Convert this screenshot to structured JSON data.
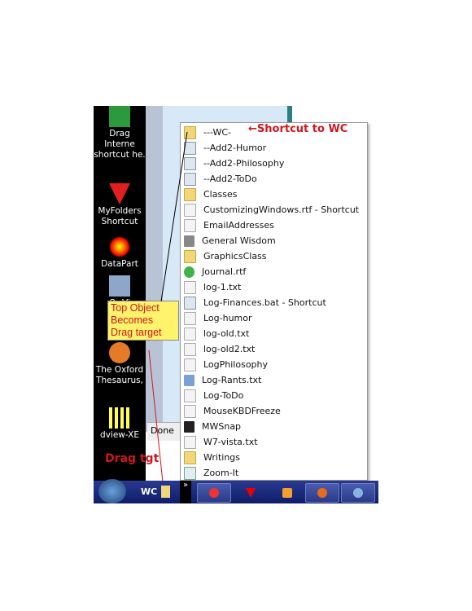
{
  "desktop": {
    "icons": [
      {
        "label": "Drag Interne shortcut he.",
        "icon": "green-arrow-shortcut-icon"
      },
      {
        "label": "MyFolders Shortcut",
        "icon": "red-triangles-icon"
      },
      {
        "label": "DataPart",
        "icon": "starburst-icon"
      },
      {
        "label": "Or Vi",
        "icon": "virtualbox-cube-icon"
      },
      {
        "label": "The Oxford Thesaurus,",
        "icon": "oxford-thesaurus-icon"
      },
      {
        "label": "dview-XE",
        "icon": "dview-icon"
      }
    ]
  },
  "window": {
    "done_label": "Done"
  },
  "jump_menu": {
    "items": [
      {
        "label": "---WC-",
        "icon": "folder"
      },
      {
        "label": "--Add2-Humor",
        "icon": "gear"
      },
      {
        "label": "--Add2-Philosophy",
        "icon": "gear"
      },
      {
        "label": "--Add2-ToDo",
        "icon": "gear"
      },
      {
        "label": "Classes",
        "icon": "folder"
      },
      {
        "label": "CustomizingWindows.rtf - Shortcut",
        "icon": "doc"
      },
      {
        "label": "EmailAddresses",
        "icon": "doc"
      },
      {
        "label": "General Wisdom",
        "icon": "print"
      },
      {
        "label": "GraphicsClass",
        "icon": "folder"
      },
      {
        "label": "Journal.rtf",
        "icon": "play"
      },
      {
        "label": "log-1.txt",
        "icon": "doc"
      },
      {
        "label": "Log-Finances.bat - Shortcut",
        "icon": "gear"
      },
      {
        "label": "Log-humor",
        "icon": "doc"
      },
      {
        "label": "log-old.txt",
        "icon": "doc"
      },
      {
        "label": "log-old2.txt",
        "icon": "doc"
      },
      {
        "label": "LogPhilosophy",
        "icon": "doc"
      },
      {
        "label": "Log-Rants.txt",
        "icon": "people"
      },
      {
        "label": "Log-ToDo",
        "icon": "doc"
      },
      {
        "label": "MouseKBDFreeze",
        "icon": "doc"
      },
      {
        "label": "MWSnap",
        "icon": "cam"
      },
      {
        "label": "W7-vista.txt",
        "icon": "doc"
      },
      {
        "label": "Writings",
        "icon": "folder"
      },
      {
        "label": "Zoom-It",
        "icon": "zoom"
      }
    ]
  },
  "annotations": {
    "shortcut_note": "←Shortcut to WC",
    "callout": [
      "Top Object",
      "Becomes",
      "Drag target"
    ],
    "drag_tgt": "Drag tgt",
    "color": "#d0161c"
  },
  "taskbar": {
    "toolbar_label": "WC",
    "chevron": "»",
    "buttons": [
      "starburst-app",
      "myfolders-app",
      "media-app",
      "firefox-app",
      "thunderbird-app"
    ]
  }
}
